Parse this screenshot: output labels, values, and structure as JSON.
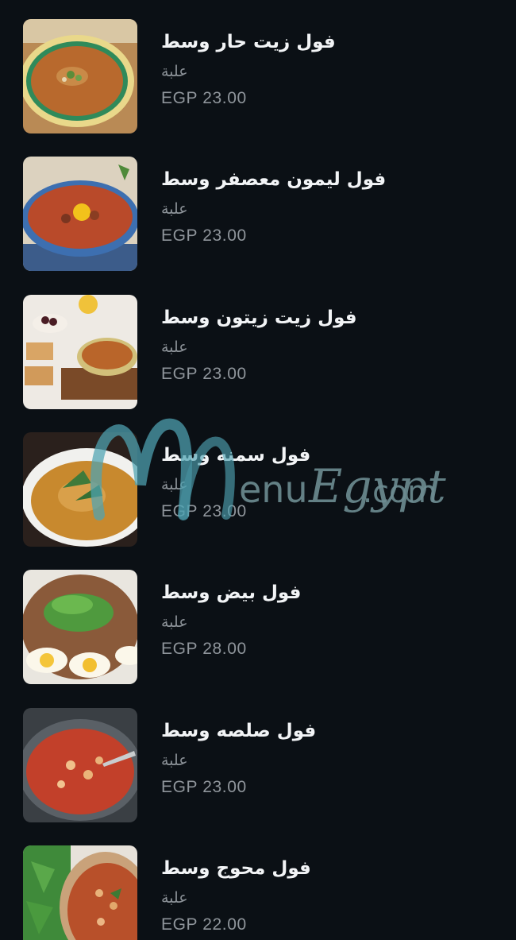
{
  "watermark": {
    "text": "MenuEgypt.com",
    "color": "#4fa3b3"
  },
  "menu": {
    "items": [
      {
        "name": "فول زيت حار وسط",
        "unit": "علبة",
        "price": "EGP 23.00",
        "image": "spicy-oil-fava-beans-bowl"
      },
      {
        "name": "فول ليمون معصفر وسط",
        "unit": "علبة",
        "price": "EGP 23.00",
        "image": "lemon-fava-beans-bowl"
      },
      {
        "name": "فول زيت زيتون وسط",
        "unit": "علبة",
        "price": "EGP 23.00",
        "image": "olive-oil-fava-beans-bowl"
      },
      {
        "name": "فول سمنه وسط",
        "unit": "علبة",
        "price": "EGP 23.00",
        "image": "ghee-fava-beans-bowl"
      },
      {
        "name": "فول بيض وسط",
        "unit": "علبة",
        "price": "EGP 28.00",
        "image": "egg-fava-beans-plate"
      },
      {
        "name": "فول صلصه وسط",
        "unit": "علبة",
        "price": "EGP 23.00",
        "image": "tomato-sauce-fava-beans-bowl"
      },
      {
        "name": "فول محوج وسط",
        "unit": "علبة",
        "price": "EGP 22.00",
        "image": "spiced-fava-beans-bowl"
      }
    ]
  }
}
